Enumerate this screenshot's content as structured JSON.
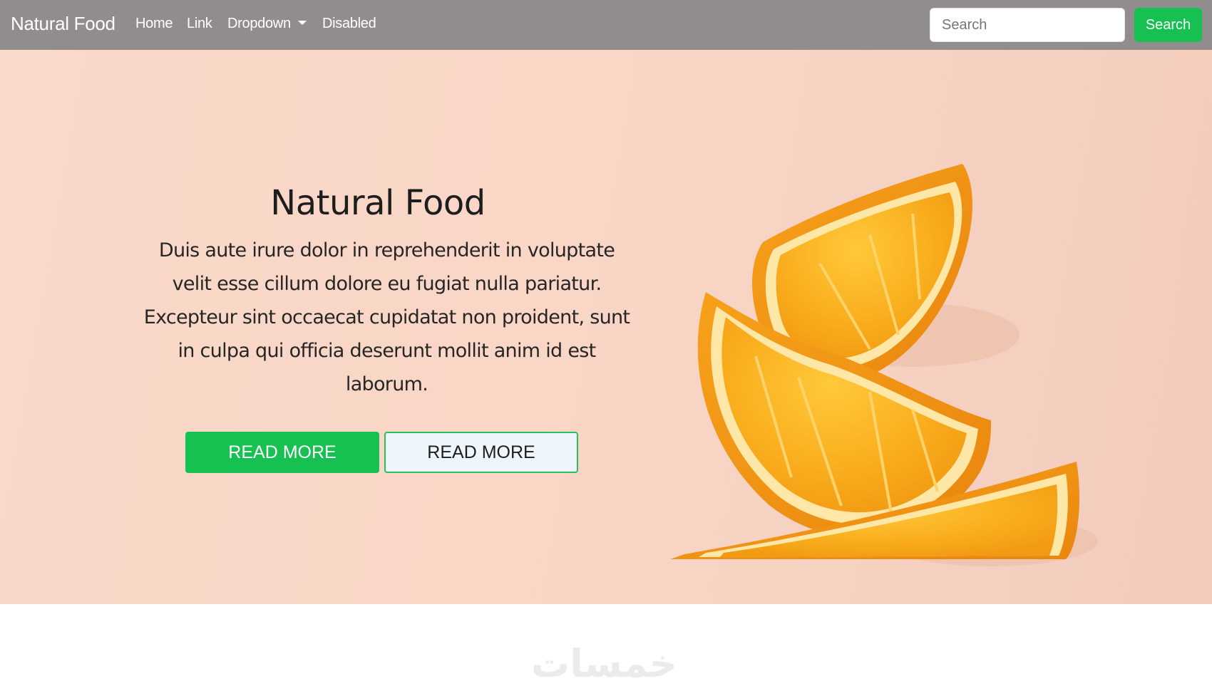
{
  "navbar": {
    "brand": "Natural Food",
    "links": [
      {
        "label": "Home"
      },
      {
        "label": "Link"
      },
      {
        "label": "Dropdown"
      },
      {
        "label": "Disabled"
      }
    ],
    "search_placeholder": "Search",
    "search_button": "Search"
  },
  "hero": {
    "title": "Natural Food",
    "text": "Duis aute irure dolor in reprehenderit in voluptate velit esse cillum dolore eu fugiat nulla pariatur. Excepteur sint occaecat cupidatat non proident, sunt in culpa qui officia deserunt mollit anim id est laborum.",
    "primary_button": "READ MORE",
    "secondary_button": "READ MORE",
    "image": "orange-slices-photo"
  },
  "watermark": "خمسات",
  "colors": {
    "navbar_bg": "#918d8c",
    "accent_green": "#16c152",
    "hero_bg": "#f9d6c6",
    "orange": "#f7a81b"
  }
}
